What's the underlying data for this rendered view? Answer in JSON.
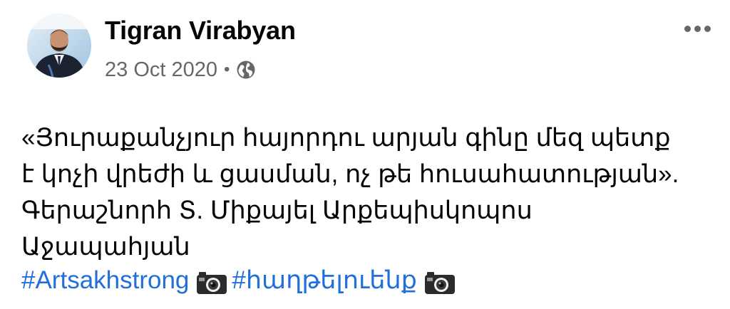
{
  "post": {
    "author": "Tigran Virabyan",
    "date": "23 Oct 2020",
    "separator": "•",
    "privacy_icon": "globe-icon",
    "more_icon": "more-options-icon",
    "text_lines": [
      "«Յուրաքանչյուր հայորդու արյան գինը մեզ պետք",
      "է կոչի վրեժի և ցասման, ոչ թե հուսահատության».",
      "Գերաշնորհ Տ. Միքայել Արքեպիսկոպոս",
      "Աջապահյան"
    ],
    "hashtags": [
      "#Artsakhstrong",
      "#հաղթելուենք"
    ],
    "emoji_icon": "camera-icon"
  },
  "colors": {
    "link": "#216fdb",
    "text": "#050505",
    "secondary": "#65676b"
  }
}
